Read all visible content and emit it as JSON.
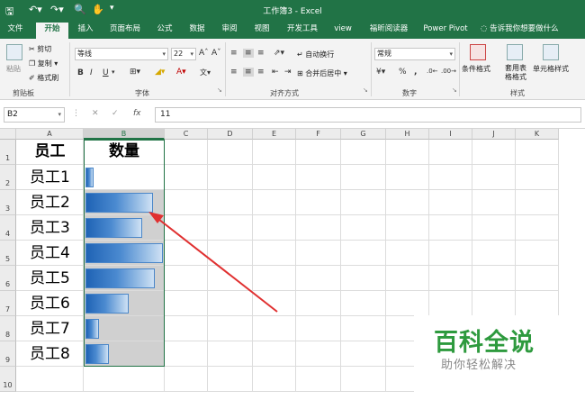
{
  "window": {
    "title": "工作簿3  -  Excel",
    "quick_access": [
      "save-icon",
      "undo-icon",
      "redo-icon",
      "print-preview-icon",
      "touch-mode-icon",
      "customize-icon"
    ]
  },
  "tabs": [
    {
      "label": "文件",
      "active": false
    },
    {
      "label": "开始",
      "active": true
    },
    {
      "label": "插入",
      "active": false
    },
    {
      "label": "页面布局",
      "active": false
    },
    {
      "label": "公式",
      "active": false
    },
    {
      "label": "数据",
      "active": false
    },
    {
      "label": "审阅",
      "active": false
    },
    {
      "label": "视图",
      "active": false
    },
    {
      "label": "开发工具",
      "active": false
    },
    {
      "label": "view",
      "active": false
    },
    {
      "label": "福昕阅读器",
      "active": false
    },
    {
      "label": "Power Pivot",
      "active": false
    }
  ],
  "tell_me": "告诉我你想要做什么",
  "ribbon": {
    "clipboard": {
      "paste": "粘贴",
      "cut": "剪切",
      "copy": "复制",
      "format_painter": "格式刷",
      "label": "剪贴板"
    },
    "font": {
      "name": "等线",
      "size": "22",
      "label": "字体",
      "bold": "B",
      "italic": "I",
      "underline": "U"
    },
    "alignment": {
      "wrap": "自动换行",
      "merge": "合并后居中",
      "label": "对齐方式"
    },
    "number": {
      "format": "常规",
      "percent": "%",
      "comma": ",",
      "label": "数字"
    },
    "styles": {
      "conditional": "条件格式",
      "table": "套用表格格式",
      "cell_styles": "单元格样式",
      "label": "样式"
    }
  },
  "formula_bar": {
    "name_box": "B2",
    "value": "11",
    "fx": "fx"
  },
  "sheet": {
    "columns": [
      "A",
      "B",
      "C",
      "D",
      "E",
      "F",
      "G",
      "H",
      "I",
      "J",
      "K"
    ],
    "rows": [
      "1",
      "2",
      "3",
      "4",
      "5",
      "6",
      "7",
      "8",
      "9",
      "10"
    ],
    "header": {
      "a": "员工",
      "b": "数量"
    },
    "employees": [
      "员工1",
      "员工2",
      "员工3",
      "员工4",
      "员工5",
      "员工6",
      "员工7",
      "员工8"
    ],
    "databar_fraction": [
      0.1,
      0.87,
      0.73,
      1.0,
      0.9,
      0.56,
      0.17,
      0.3
    ],
    "databar_color": "#1f63b5",
    "selected_column": "B"
  },
  "watermark": {
    "title": "百科全说",
    "subtitle": "助你轻松解决"
  },
  "colors": {
    "excel_green": "#217346",
    "watermark_green": "#2e9a3e",
    "annotation_red": "#e03030"
  }
}
